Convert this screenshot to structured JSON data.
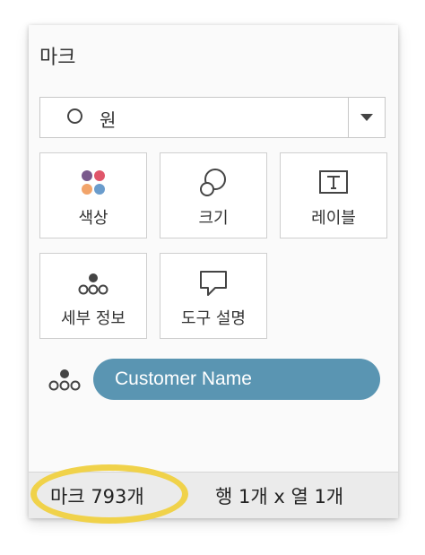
{
  "panel": {
    "title": "마크"
  },
  "mark_type": {
    "icon": "circle-icon",
    "selected": "원"
  },
  "cards": [
    {
      "id": "color",
      "label": "색상",
      "icon": "color-dots-icon"
    },
    {
      "id": "size",
      "label": "크기",
      "icon": "size-circles-icon"
    },
    {
      "id": "label",
      "label": "레이블",
      "icon": "text-box-icon"
    },
    {
      "id": "detail",
      "label": "세부 정보",
      "icon": "detail-dots-icon"
    },
    {
      "id": "tooltip",
      "label": "도구 설명",
      "icon": "speech-bubble-icon"
    }
  ],
  "field_pill": {
    "icon": "detail-dots-icon",
    "label": "Customer Name"
  },
  "status_bar": {
    "mark_count": "마크 793개",
    "dimensions": "행 1개 x 열 1개"
  },
  "colors": {
    "pill": "#5a95b2",
    "highlight": "#f0d24a",
    "dot_purple": "#7a5a8c",
    "dot_red": "#e0566a",
    "dot_orange": "#f2a46a",
    "dot_blue": "#6a9ccc"
  }
}
